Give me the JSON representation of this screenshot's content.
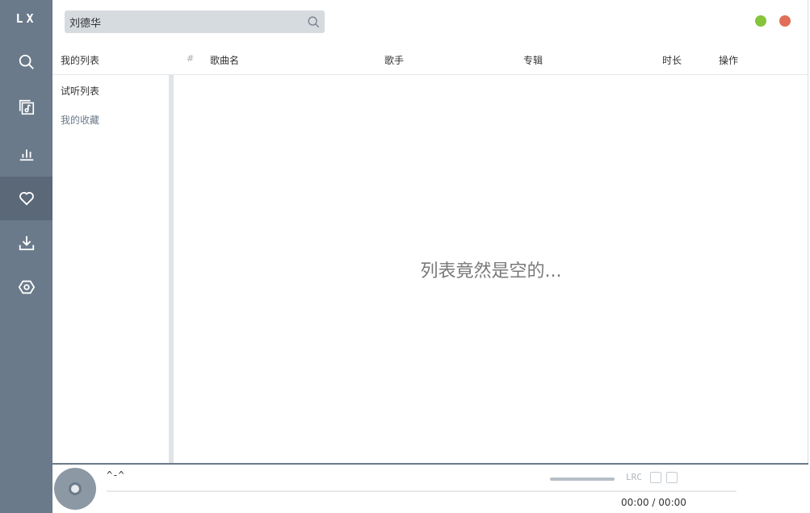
{
  "app": {
    "brand": "LX"
  },
  "sidebar": {
    "items": [
      {
        "name": "search",
        "icon": "search-icon"
      },
      {
        "name": "song-list",
        "icon": "music-list-icon"
      },
      {
        "name": "leaderboard",
        "icon": "bar-chart-icon"
      },
      {
        "name": "my-list",
        "icon": "heart-icon",
        "active": true
      },
      {
        "name": "download",
        "icon": "download-icon"
      },
      {
        "name": "settings",
        "icon": "settings-icon"
      }
    ]
  },
  "search": {
    "value": "刘德华"
  },
  "window_controls": {
    "minimize_color": "#85c43b",
    "close_color": "#e16e57"
  },
  "table": {
    "headers": {
      "my_list": "我的列表",
      "num": "#",
      "song": "歌曲名",
      "singer": "歌手",
      "album": "专辑",
      "duration": "时长",
      "action": "操作"
    }
  },
  "lists": {
    "trial": "试听列表",
    "favorites": "我的收藏"
  },
  "empty_message": "列表竟然是空的...",
  "player": {
    "title": "^-^",
    "lrc": "LRC",
    "current_time": "00:00",
    "separator": "/",
    "total_time": "00:00",
    "progress": 0
  },
  "colors": {
    "accent": "#6b7a8a",
    "active_nav": "#5a6877"
  }
}
